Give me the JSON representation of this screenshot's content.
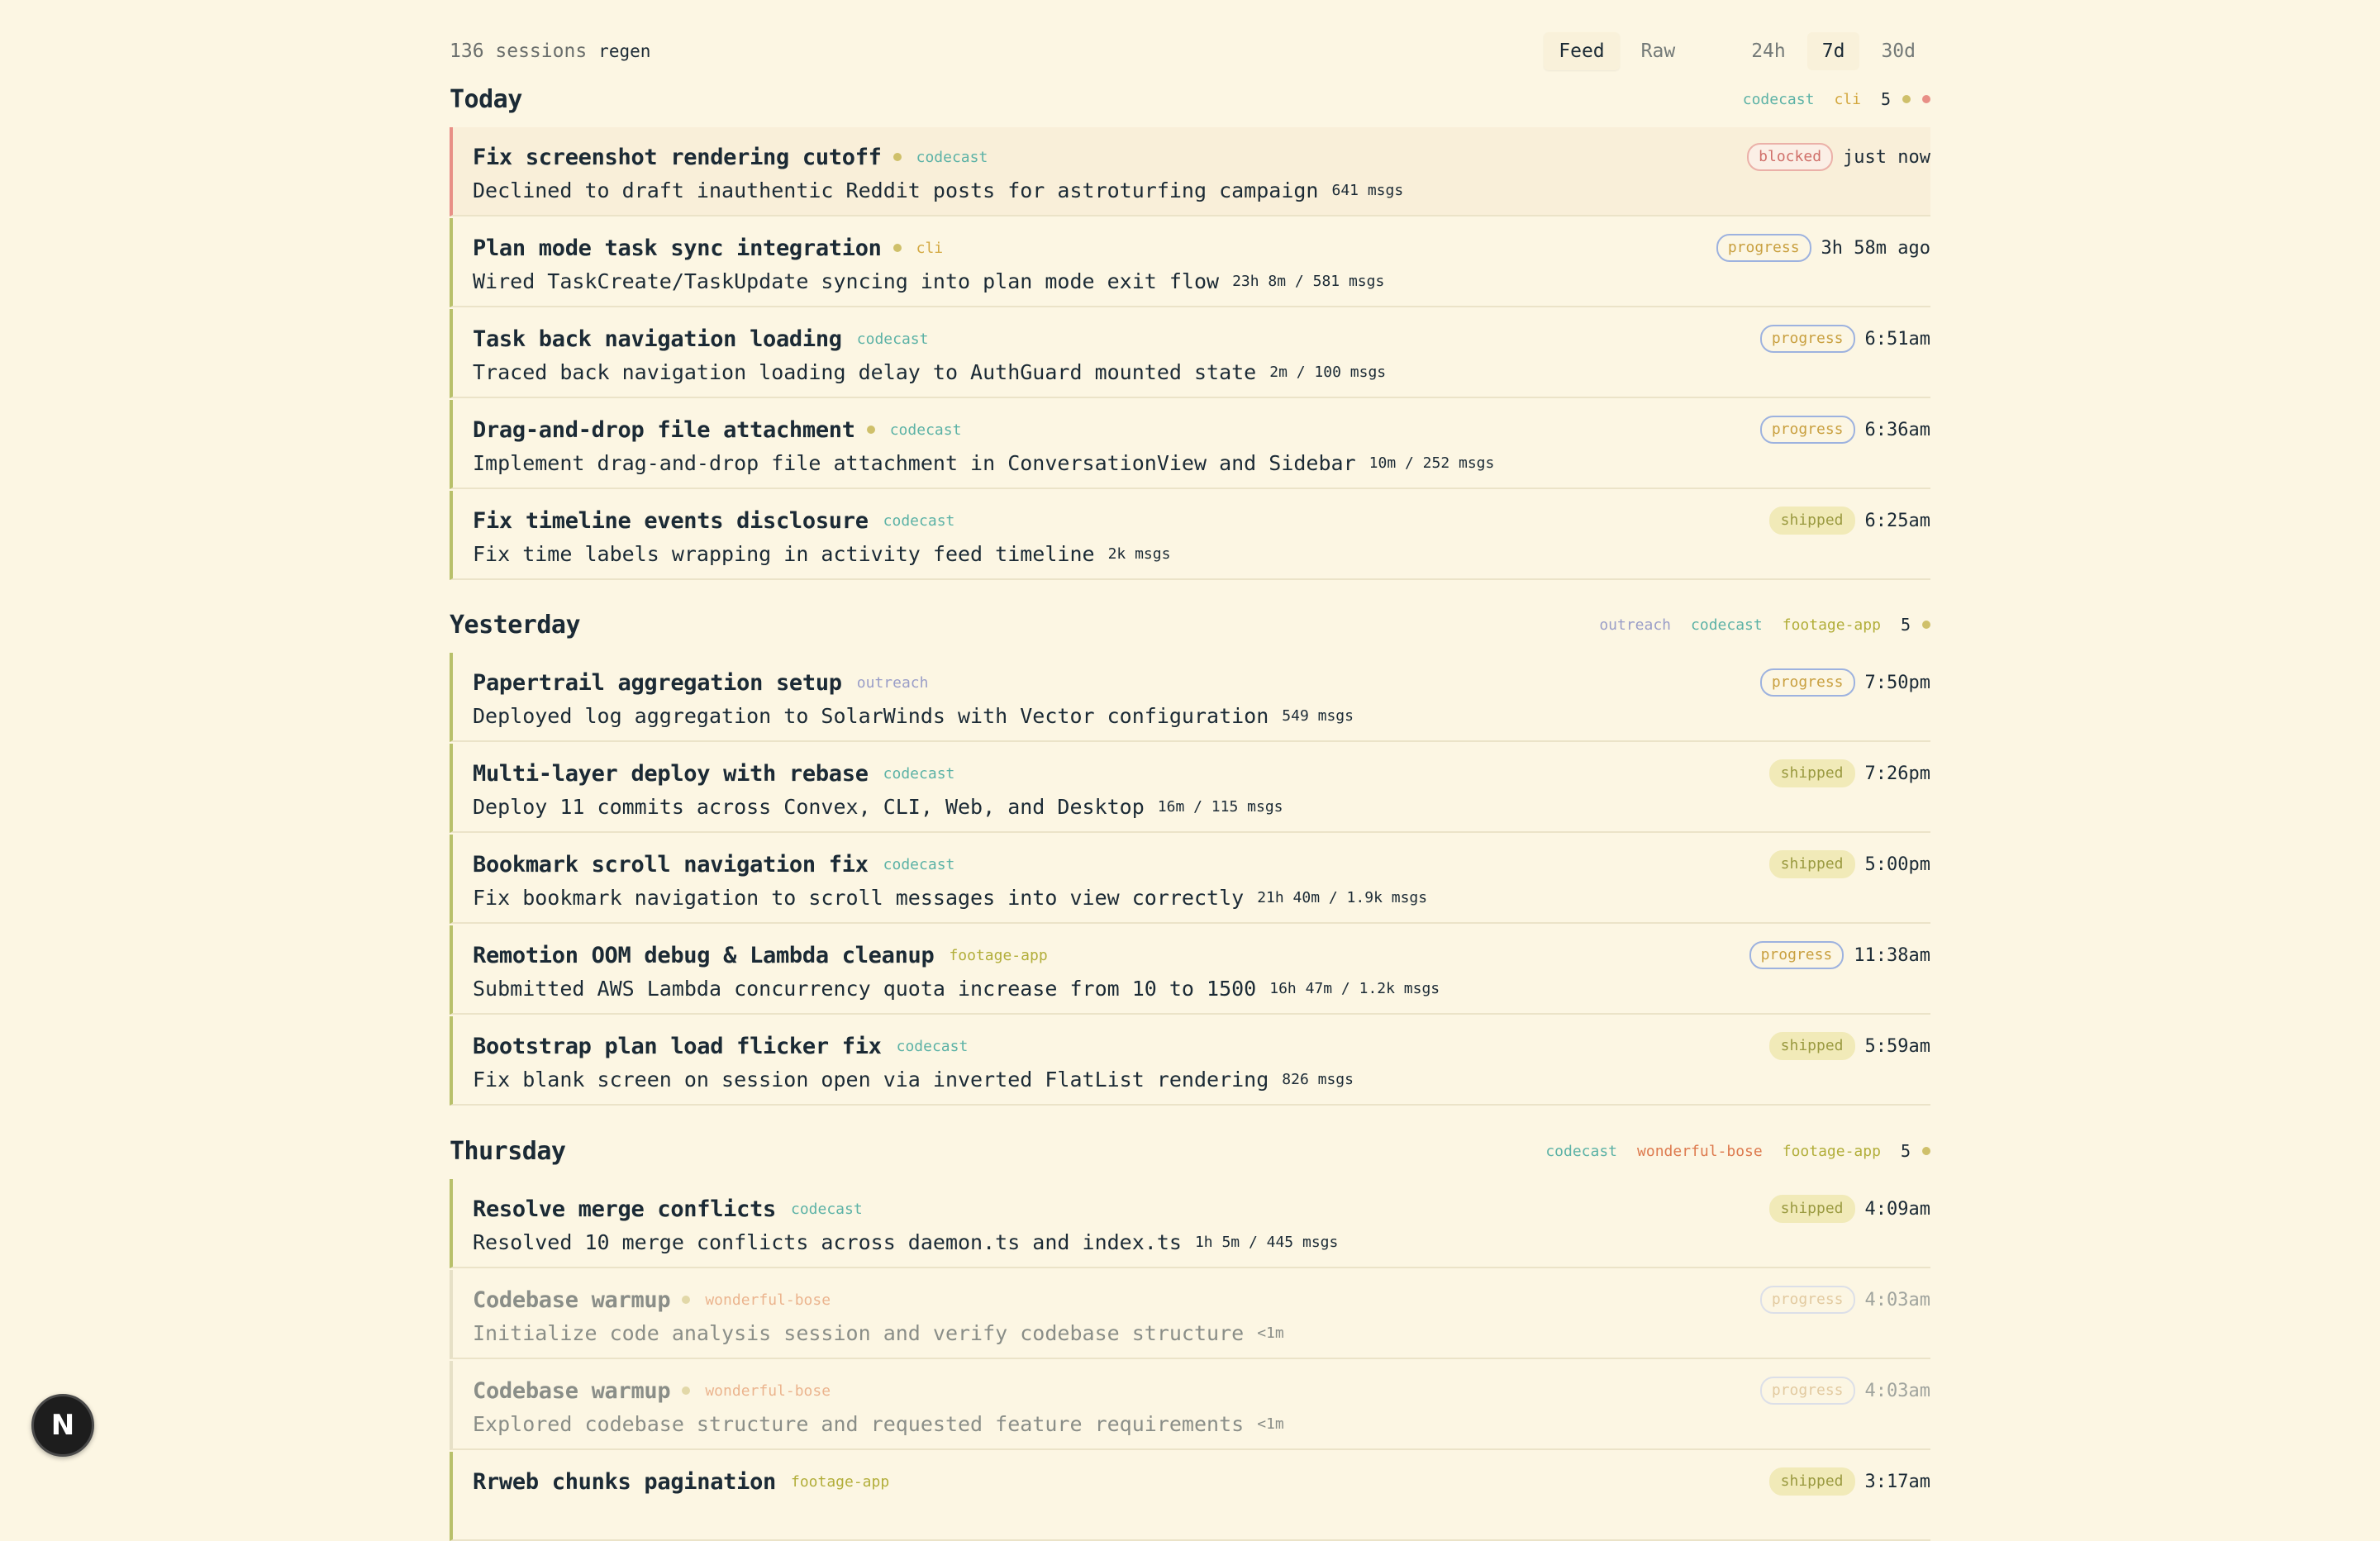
{
  "header": {
    "session_count": "136 sessions",
    "regen": "regen",
    "view_tabs": [
      "Feed",
      "Raw"
    ],
    "range_tabs": [
      "24h",
      "7d",
      "30d"
    ],
    "active_view": "Feed",
    "active_range": "7d"
  },
  "groups": [
    {
      "title": "Today",
      "projects": [
        {
          "name": "codecast",
          "color": "#5cb2a6"
        },
        {
          "name": "cli",
          "color": "#d3a840"
        }
      ],
      "count": "5",
      "dots": [
        "#cfc06a",
        "#e88f86"
      ],
      "rows": [
        {
          "title": "Fix screenshot rendering cutoff",
          "dot": true,
          "project": "codecast",
          "status": "blocked",
          "time": "just now",
          "desc": "Declined to draft inauthentic Reddit posts for astroturfing campaign",
          "stats": "641 msgs"
        },
        {
          "title": "Plan mode task sync integration",
          "dot": true,
          "project": "cli",
          "status": "progress",
          "time": "3h 58m ago",
          "desc": "Wired TaskCreate/TaskUpdate syncing into plan mode exit flow",
          "stats": "23h 8m / 581 msgs"
        },
        {
          "title": "Task back navigation loading",
          "dot": false,
          "project": "codecast",
          "status": "progress",
          "time": "6:51am",
          "desc": "Traced back navigation loading delay to AuthGuard mounted state",
          "stats": "2m / 100 msgs"
        },
        {
          "title": "Drag-and-drop file attachment",
          "dot": true,
          "project": "codecast",
          "status": "progress",
          "time": "6:36am",
          "desc": "Implement drag-and-drop file attachment in ConversationView and Sidebar",
          "stats": "10m / 252 msgs"
        },
        {
          "title": "Fix timeline events disclosure",
          "dot": false,
          "project": "codecast",
          "status": "shipped",
          "time": "6:25am",
          "desc": "Fix time labels wrapping in activity feed timeline",
          "stats": "2k msgs"
        }
      ]
    },
    {
      "title": "Yesterday",
      "projects": [
        {
          "name": "outreach",
          "color": "#9a9ec8"
        },
        {
          "name": "codecast",
          "color": "#5cb2a6"
        },
        {
          "name": "footage-app",
          "color": "#b2ae3a"
        }
      ],
      "count": "5",
      "dots": [
        "#cfc06a"
      ],
      "rows": [
        {
          "title": "Papertrail aggregation setup",
          "dot": false,
          "project": "outreach",
          "status": "progress",
          "time": "7:50pm",
          "desc": "Deployed log aggregation to SolarWinds with Vector configuration",
          "stats": "549 msgs"
        },
        {
          "title": "Multi-layer deploy with rebase",
          "dot": false,
          "project": "codecast",
          "status": "shipped",
          "time": "7:26pm",
          "desc": "Deploy 11 commits across Convex, CLI, Web, and Desktop",
          "stats": "16m / 115 msgs"
        },
        {
          "title": "Bookmark scroll navigation fix",
          "dot": false,
          "project": "codecast",
          "status": "shipped",
          "time": "5:00pm",
          "desc": "Fix bookmark navigation to scroll messages into view correctly",
          "stats": "21h 40m / 1.9k msgs"
        },
        {
          "title": "Remotion OOM debug & Lambda cleanup",
          "dot": false,
          "project": "footage-app",
          "status": "progress",
          "time": "11:38am",
          "desc": "Submitted AWS Lambda concurrency quota increase from 10 to 1500",
          "stats": "16h 47m / 1.2k msgs"
        },
        {
          "title": "Bootstrap plan load flicker fix",
          "dot": false,
          "project": "codecast",
          "status": "shipped",
          "time": "5:59am",
          "desc": "Fix blank screen on session open via inverted FlatList rendering",
          "stats": "826 msgs"
        }
      ]
    },
    {
      "title": "Thursday",
      "projects": [
        {
          "name": "codecast",
          "color": "#5cb2a6"
        },
        {
          "name": "wonderful-bose",
          "color": "#dd7a4e"
        },
        {
          "name": "footage-app",
          "color": "#b2ae3a"
        }
      ],
      "count": "5",
      "dots": [
        "#cfc06a"
      ],
      "rows": [
        {
          "title": "Resolve merge conflicts",
          "dot": false,
          "project": "codecast",
          "status": "shipped",
          "time": "4:09am",
          "desc": "Resolved 10 merge conflicts across daemon.ts and index.ts",
          "stats": "1h 5m / 445 msgs"
        },
        {
          "title": "Codebase warmup",
          "dot": true,
          "project": "wonderful-bose",
          "status": "progress",
          "time": "4:03am",
          "desc": "Initialize code analysis session and verify codebase structure",
          "stats": "<1m",
          "dim": true
        },
        {
          "title": "Codebase warmup",
          "dot": true,
          "project": "wonderful-bose",
          "status": "progress",
          "time": "4:03am",
          "desc": "Explored codebase structure and requested feature requirements",
          "stats": "<1m",
          "dim": true
        },
        {
          "title": "Rrweb chunks pagination",
          "dot": false,
          "project": "footage-app",
          "status": "shipped",
          "time": "3:17am",
          "desc": "",
          "stats": ""
        }
      ]
    }
  ],
  "fab": {
    "letter": "N"
  }
}
